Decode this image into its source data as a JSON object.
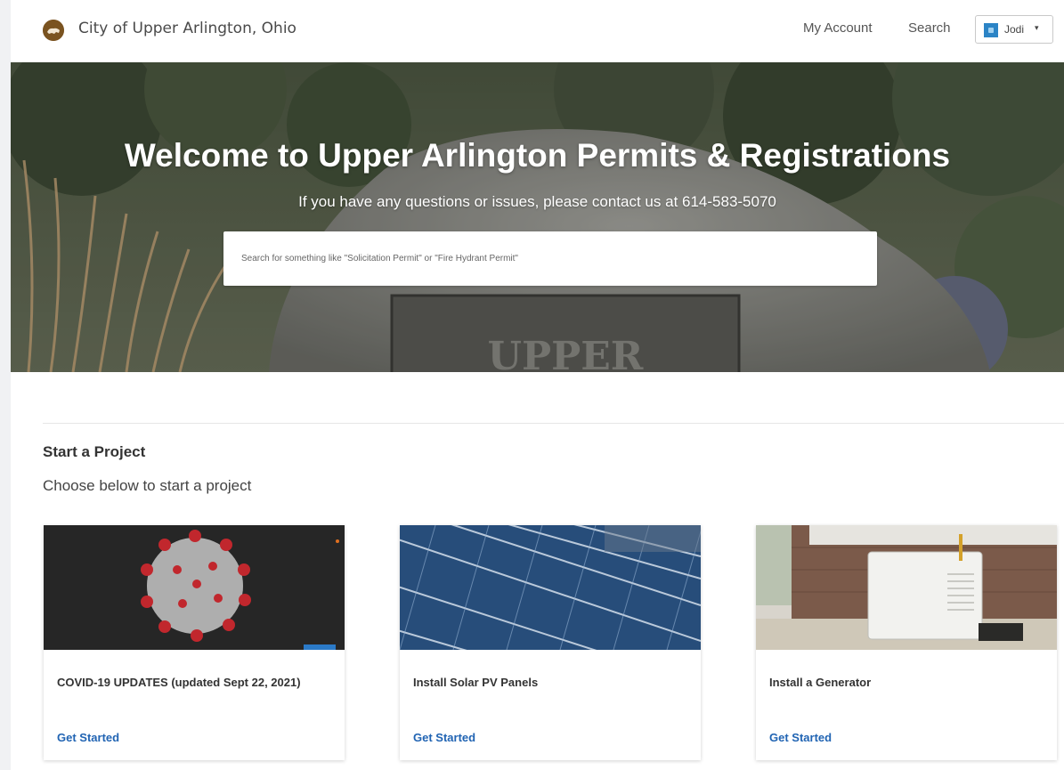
{
  "header": {
    "site_title": "City of Upper Arlington, Ohio",
    "nav": {
      "my_account": "My Account",
      "search": "Search"
    },
    "user": {
      "name": "Jodi",
      "caret": "▾"
    }
  },
  "hero": {
    "title": "Welcome to Upper Arlington Permits & Registrations",
    "subtitle": "If you have any questions or issues, please contact us at 614-583-5070",
    "search_placeholder": "Search for something like \"Solicitation Permit\" or \"Fire Hydrant Permit\"",
    "sign_text": "UPPER"
  },
  "projects": {
    "title": "Start a Project",
    "subtitle": "Choose below to start a project",
    "cards": [
      {
        "title": "COVID-19 UPDATES (updated Sept 22, 2021)",
        "link": "Get Started"
      },
      {
        "title": "Install Solar PV Panels",
        "link": "Get Started"
      },
      {
        "title": "Install a Generator",
        "link": "Get Started"
      }
    ]
  },
  "colors": {
    "link": "#2164b3",
    "avatar": "#2b84c6",
    "logo": "#7a5320"
  }
}
